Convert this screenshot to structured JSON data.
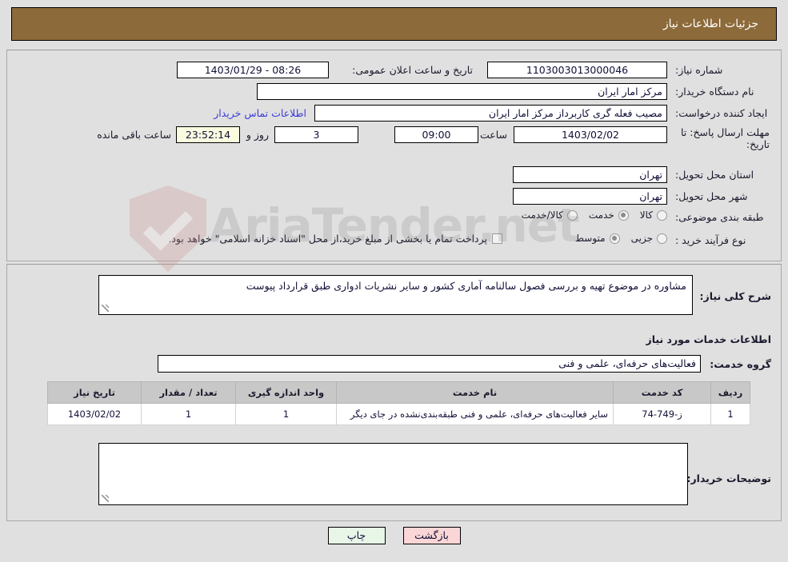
{
  "header": {
    "title": "جزئیات اطلاعات نیاز"
  },
  "info": {
    "need_number_label": "شماره نیاز:",
    "need_number": "1103003013000046",
    "announce_label": "تاریخ و ساعت اعلان عمومی:",
    "announce_value": "08:26 - 1403/01/29",
    "buyer_org_label": "نام دستگاه خریدار:",
    "buyer_org": "مرکز امار ایران",
    "creator_label": "ایجاد کننده درخواست:",
    "creator": "مصیب فعله گری کاربرداز مرکز امار ایران",
    "contact_link": "اطلاعات تماس خریدار",
    "deadline_label": "مهلت ارسال پاسخ: تا تاریخ:",
    "deadline_date": "1403/02/02",
    "hour_label": "ساعت",
    "deadline_time": "09:00",
    "days_remaining": "3",
    "days_word": "روز و",
    "countdown": "23:52:14",
    "remaining_word": "ساعت باقی مانده",
    "province_label": "استان محل تحویل:",
    "province": "تهران",
    "city_label": "شهر محل تحویل:",
    "city": "تهران",
    "category_label": "طبقه بندی موضوعی:",
    "category_options": [
      {
        "label": "کالا",
        "selected": false
      },
      {
        "label": "خدمت",
        "selected": true
      },
      {
        "label": "کالا/خدمت",
        "selected": false
      }
    ],
    "process_label": "نوع فرآیند خرید :",
    "process_options": [
      {
        "label": "جزیی",
        "selected": false
      },
      {
        "label": "متوسط",
        "selected": true
      }
    ],
    "treasury_checkbox_text": "پرداخت تمام یا بخشی از مبلغ خرید،از محل \"اسناد خزانه اسلامی\" خواهد بود.",
    "treasury_checked": false
  },
  "detail": {
    "general_desc_label": "شرح کلی نیاز:",
    "general_desc": "مشاوره در موضوع تهیه و بررسی فصول سالنامه آماری کشور و سایر نشریات ادواری طبق قرارداد پیوست",
    "services_section_title": "اطلاعات خدمات مورد نیاز",
    "service_group_label": "گروه خدمت:",
    "service_group": "فعالیت‌های حرفه‌ای، علمی و فنی",
    "table": {
      "columns": [
        "ردیف",
        "کد خدمت",
        "نام خدمت",
        "واحد اندازه گیری",
        "تعداد / مقدار",
        "تاریخ نیاز"
      ],
      "rows": [
        {
          "row_no": "1",
          "service_code": "ز-749-74",
          "service_name": "سایر فعالیت‌های حرفه‌ای، علمی و فنی طبقه‌بندی‌نشده در جای دیگر",
          "unit": "1",
          "quantity": "1",
          "need_date": "1403/02/02"
        }
      ]
    },
    "buyer_notes_label": "توضیحات خریدار:",
    "buyer_notes": ""
  },
  "buttons": {
    "print": "چاپ",
    "back": "بازگشت"
  },
  "watermark": {
    "text": "AriaTender.net"
  }
}
